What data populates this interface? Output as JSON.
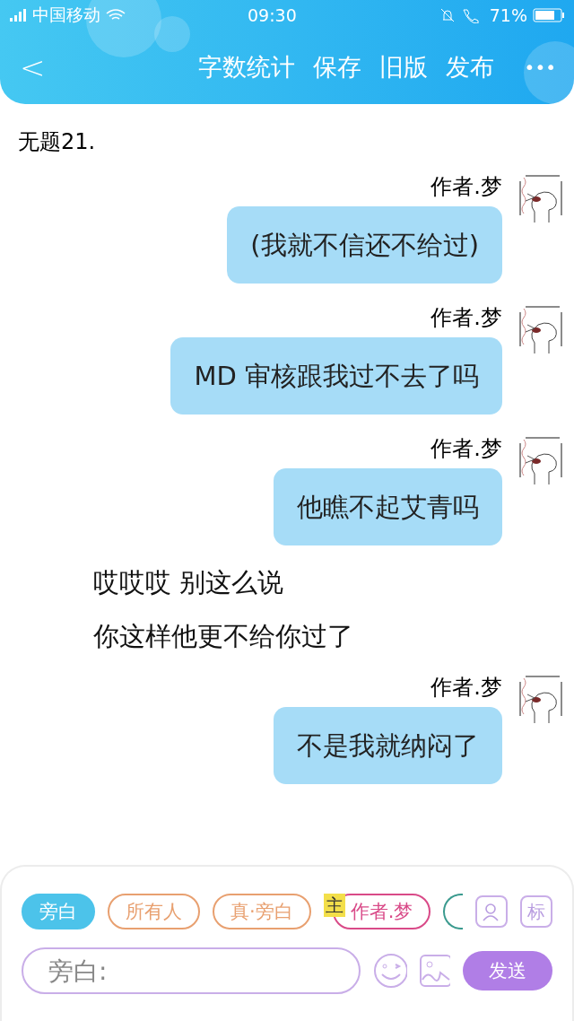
{
  "status_bar": {
    "carrier": "中国移动",
    "time": "09:30",
    "battery": "71%"
  },
  "nav": {
    "back": "<",
    "actions": [
      "字数统计",
      "保存",
      "旧版",
      "发布"
    ],
    "more": "•••"
  },
  "title": "无题21.",
  "messages": [
    {
      "kind": "author",
      "name": "作者.梦",
      "text": "(我就不信还不给过)"
    },
    {
      "kind": "author",
      "name": "作者.梦",
      "text": "MD 审核跟我过不去了吗"
    },
    {
      "kind": "author",
      "name": "作者.梦",
      "text": "他瞧不起艾青吗"
    },
    {
      "kind": "narration",
      "text": "哎哎哎 别这么说"
    },
    {
      "kind": "narration",
      "text": "你这样他更不给你过了"
    },
    {
      "kind": "author",
      "name": "作者.梦",
      "text": "不是我就纳闷了"
    }
  ],
  "roles": [
    {
      "label": "旁白",
      "selected": true,
      "color": "#4cc3ea"
    },
    {
      "label": "所有人",
      "selected": false,
      "color": "#e8a070"
    },
    {
      "label": "真·旁白",
      "selected": false,
      "color": "#e8a070"
    },
    {
      "label": "作者.梦",
      "selected": false,
      "color": "#d94a88",
      "badge": "主"
    },
    {
      "color": "#3a9a8e"
    }
  ],
  "tag_button": "标",
  "input": {
    "placeholder": "旁白:"
  },
  "send": "发送"
}
